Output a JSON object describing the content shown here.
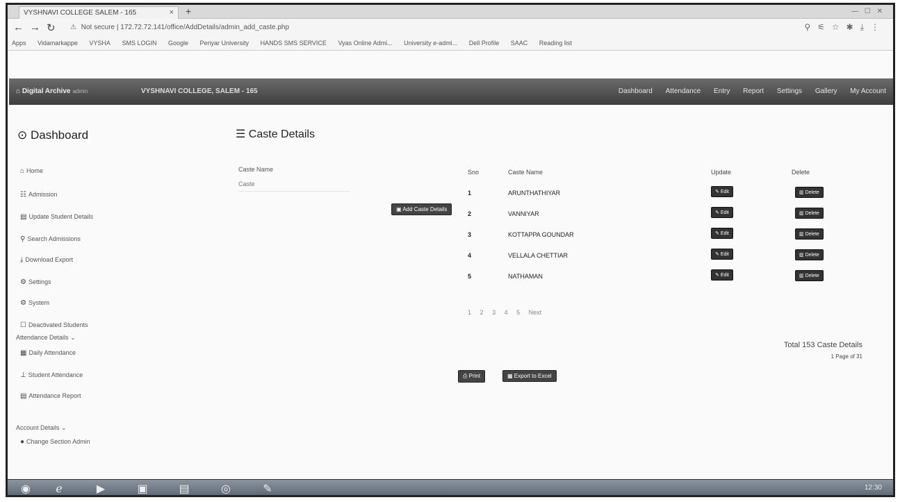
{
  "browser": {
    "tab_title": "VYSHNAVI COLLEGE SALEM - 165",
    "tab_close": "×",
    "new_tab": "+",
    "window_controls": "— ☐ ✕",
    "url_warning": "Not secure",
    "url": "172.72.72.141/office/AddDetails/admin_add_caste.php",
    "bookmarks": [
      "Apps",
      "Vidamarkappe",
      "VYSHA",
      "SMS LOGIN",
      "Google",
      "Periyar University",
      "HANDS SMS SERVICE",
      "Vyas Online Admi...",
      "University e-admi...",
      "Dell Profile",
      "SAAC",
      "Reading list"
    ]
  },
  "appnav": {
    "brand": "Digital Archive",
    "brand_sub": "admin",
    "college": "VYSHNAVI COLLEGE, SALEM - 165",
    "menu": [
      "Dashboard",
      "Attendance",
      "Entry",
      "Report",
      "Settings",
      "Gallery",
      "My Account"
    ]
  },
  "sidebar": {
    "title": "Dashboard",
    "items": [
      {
        "icon": "home-icon",
        "glyph": "⌂",
        "label": "Home"
      },
      {
        "icon": "admission-icon",
        "glyph": "☷",
        "label": "Admission"
      },
      {
        "icon": "update-student-icon",
        "glyph": "▤",
        "label": "Update Student Details"
      },
      {
        "icon": "search-icon",
        "glyph": "⚲",
        "label": "Search Admissions"
      },
      {
        "icon": "download-icon",
        "glyph": "⤓",
        "label": "Download Export"
      },
      {
        "icon": "settings-icon",
        "glyph": "⚙",
        "label": "Settings"
      },
      {
        "icon": "system-icon",
        "glyph": "⚙",
        "label": "System"
      },
      {
        "icon": "deactivated-icon",
        "glyph": "☐",
        "label": "Deactivated Students"
      }
    ],
    "attendance_section": "Attendance Details",
    "attendance_items": [
      {
        "icon": "calendar-icon",
        "glyph": "▦",
        "label": "Daily Attendance"
      },
      {
        "icon": "student-attendance-icon",
        "glyph": "⊥",
        "label": "Student Attendance"
      },
      {
        "icon": "report-icon",
        "glyph": "▤",
        "label": "Attendance Report"
      }
    ],
    "account_section": "Account Details",
    "account_items": [
      {
        "icon": "password-icon",
        "glyph": "●",
        "label": "Change Section Admin"
      }
    ]
  },
  "main": {
    "title": "Caste Details",
    "form": {
      "label": "Caste Name",
      "placeholder": "Caste",
      "submit": "Add Caste Details"
    },
    "table": {
      "headers": [
        "Sno",
        "Caste Name",
        "Update",
        "Delete"
      ],
      "edit_label": "Edit",
      "delete_label": "Delete",
      "rows": [
        {
          "sno": "1",
          "name": "ARUNTHATHIYAR"
        },
        {
          "sno": "2",
          "name": "VANNIYAR"
        },
        {
          "sno": "3",
          "name": "KOTTAPPA GOUNDAR"
        },
        {
          "sno": "4",
          "name": "VELLALA CHETTIAR"
        },
        {
          "sno": "5",
          "name": "NATHAMAN"
        }
      ]
    },
    "pagination": [
      "1",
      "2",
      "3",
      "4",
      "5",
      "Next"
    ],
    "total": "Total 153 Caste Details",
    "page_of": "1 Page of 31",
    "bottom_buttons": [
      "Print",
      "Export to Excel"
    ]
  },
  "taskbar": {
    "clock": "12:30"
  },
  "colors": {
    "navbar": "#4a4a4a",
    "button": "#333333",
    "taskbar": "#6a7580"
  }
}
